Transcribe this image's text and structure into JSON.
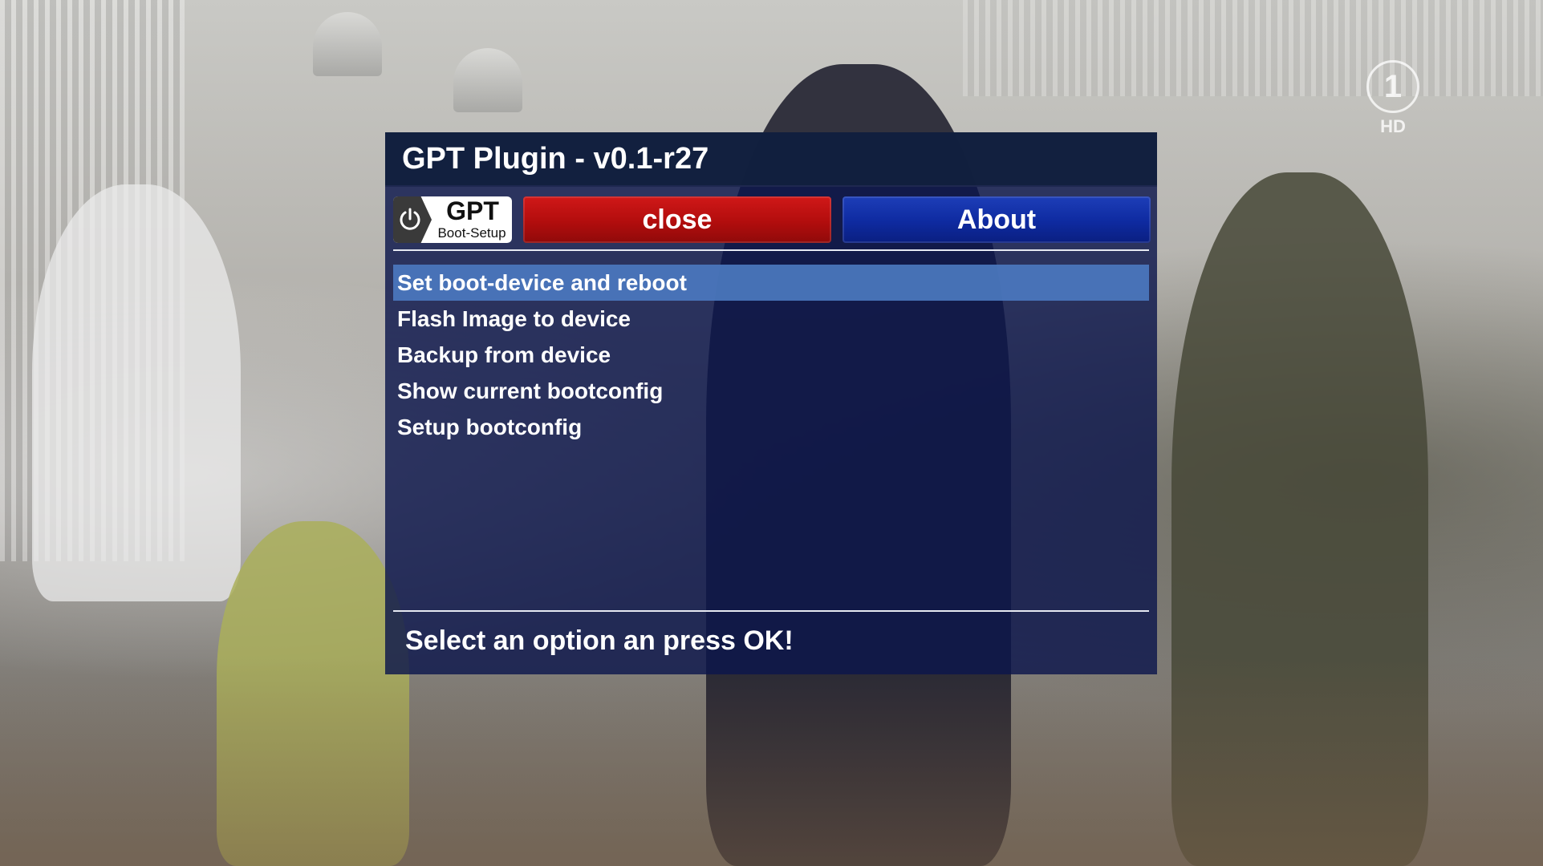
{
  "channel": {
    "logo_mark": "1",
    "logo_label": "HD"
  },
  "dialog": {
    "title": "GPT Plugin - v0.1-r27",
    "logo": {
      "icon": "power-icon",
      "title": "GPT",
      "subtitle": "Boot-Setup"
    },
    "buttons": {
      "close_label": "close",
      "about_label": "About",
      "close_color": "#c01212",
      "about_color": "#1232a8"
    },
    "menu": {
      "selected_index": 0,
      "items": [
        {
          "label": "Set boot-device and reboot"
        },
        {
          "label": "Flash Image to device"
        },
        {
          "label": "Backup from device"
        },
        {
          "label": "Show current bootconfig"
        },
        {
          "label": "Setup bootconfig"
        }
      ]
    },
    "status_text": "Select an option an press OK!"
  },
  "colors": {
    "dialog_bg": "#0c164c",
    "titlebar_bg": "#12203e",
    "selection": "#4a76bc"
  }
}
